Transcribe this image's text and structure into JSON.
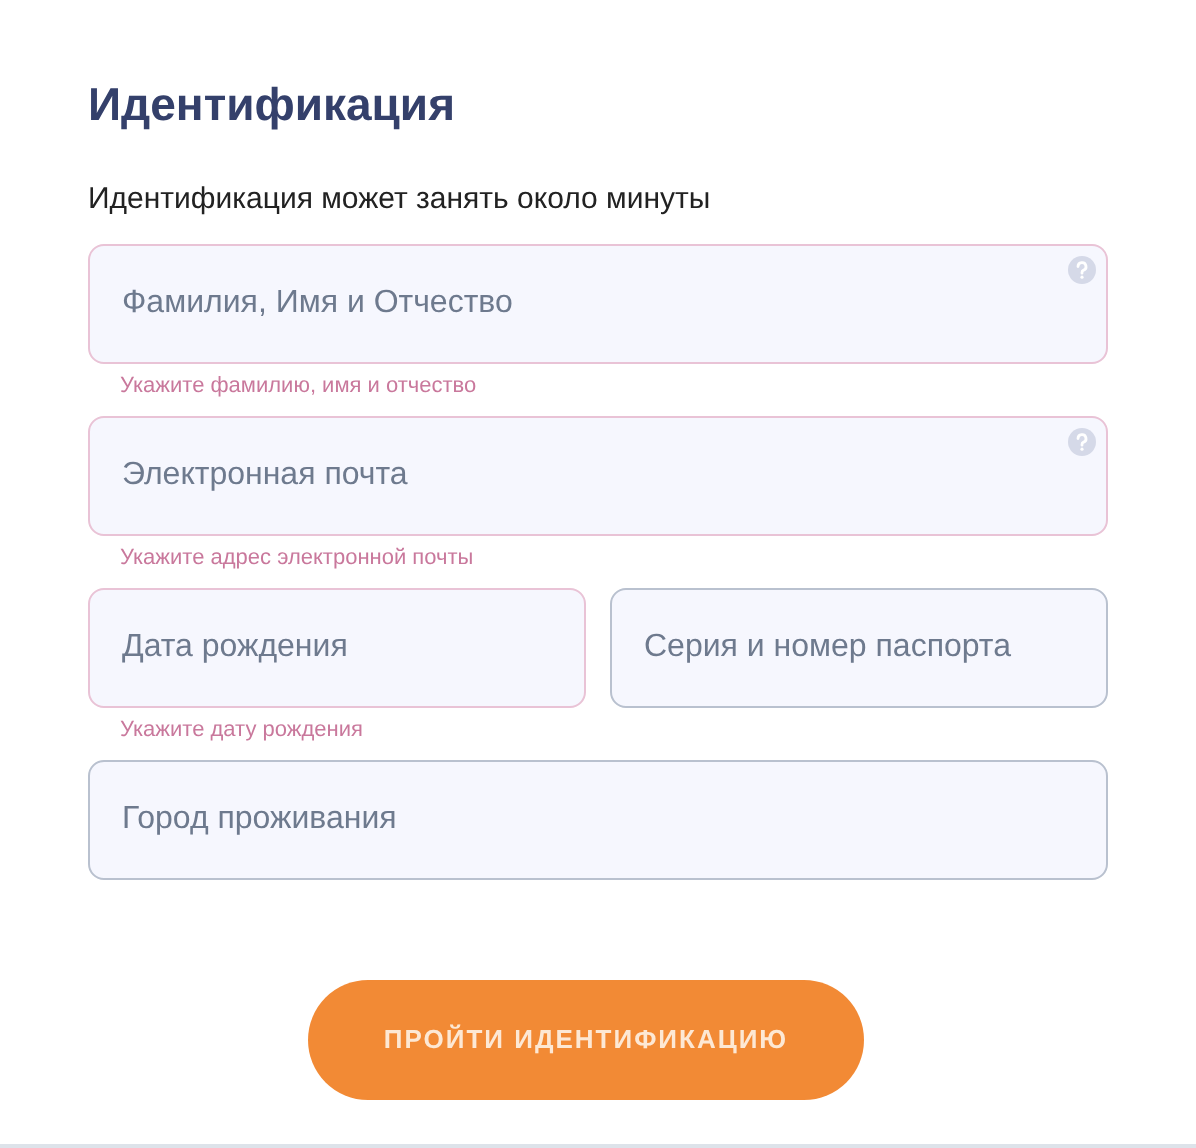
{
  "title": "Идентификация",
  "subtitle": "Идентификация может занять около минуты",
  "form_rows": [
    [
      {
        "placeholder": "Фамилия, Имя и Отчество",
        "invalid": true,
        "help": true,
        "error": "Укажите фамилию, имя и отчество"
      }
    ],
    [
      {
        "placeholder": "Электронная почта",
        "invalid": true,
        "help": true,
        "error": "Укажите адрес электронной почты"
      }
    ],
    [
      {
        "placeholder": "Дата рождения",
        "invalid": true,
        "help": false,
        "error": "Укажите дату рождения"
      },
      {
        "placeholder": "Серия и номер паспорта",
        "invalid": false,
        "help": false
      }
    ],
    [
      {
        "placeholder": "Город проживания",
        "invalid": false,
        "help": false
      }
    ]
  ],
  "submit_button": "ПРОЙТИ ИДЕНТИФИКАЦИЮ"
}
